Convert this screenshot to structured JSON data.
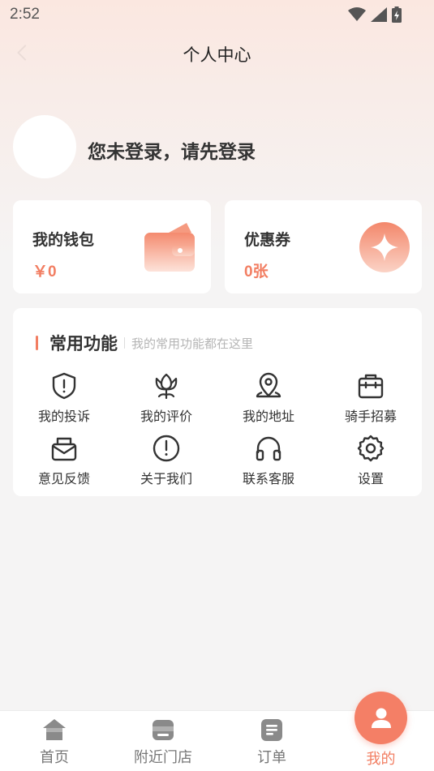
{
  "status_bar": {
    "time": "2:52"
  },
  "nav": {
    "title": "个人中心"
  },
  "profile": {
    "login_prompt": "您未登录，请先登录"
  },
  "wallet": {
    "title": "我的钱包",
    "value": "￥0"
  },
  "coupon": {
    "title": "优惠券",
    "value": "0张"
  },
  "functions": {
    "title": "常用功能",
    "subtitle": "我的常用功能都在这里",
    "items": [
      {
        "label": "我的投诉",
        "icon": "shield-alert-icon"
      },
      {
        "label": "我的评价",
        "icon": "flower-icon"
      },
      {
        "label": "我的地址",
        "icon": "location-pin-icon"
      },
      {
        "label": "骑手招募",
        "icon": "toolbox-icon"
      },
      {
        "label": "意见反馈",
        "icon": "mail-box-icon"
      },
      {
        "label": "关于我们",
        "icon": "info-alert-icon"
      },
      {
        "label": "联系客服",
        "icon": "headphones-icon"
      },
      {
        "label": "设置",
        "icon": "gear-icon"
      }
    ]
  },
  "tabbar": {
    "tabs": [
      {
        "label": "首页",
        "icon": "home-icon"
      },
      {
        "label": "附近门店",
        "icon": "store-icon"
      },
      {
        "label": "订单",
        "icon": "order-icon"
      },
      {
        "label": "我的",
        "icon": "user-icon"
      }
    ],
    "active": "我的"
  },
  "colors": {
    "accent": "#f27e62",
    "text": "#333333",
    "background": "#f5f4f4"
  }
}
